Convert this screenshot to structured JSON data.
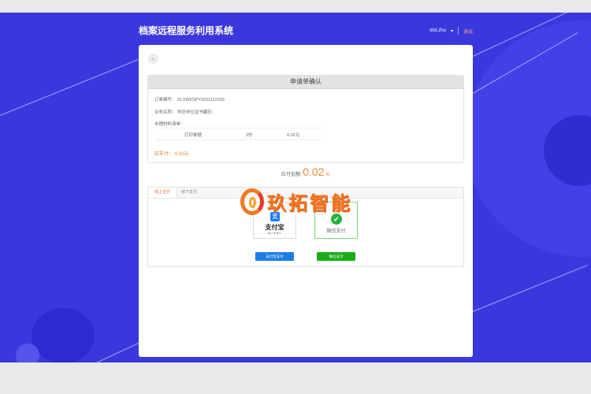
{
  "app": {
    "title": "档案远程服务利用系统"
  },
  "user": {
    "name": "dist.zhu",
    "logout_label": "退出"
  },
  "confirm": {
    "header": "申请单确认",
    "order_label": "订单编号：",
    "order_no": "XLXWZSPY2021112339",
    "business_label": "业务名称：",
    "business_name": "学历学位证书翻印",
    "items_label": "办理材料清单：",
    "items": [
      {
        "name": "打印单据",
        "count": "2份",
        "price": "0.02元"
      }
    ],
    "total_label": "应支付：",
    "total_value": "0.02元"
  },
  "payment": {
    "amount_label": "应付金额:",
    "amount": "0.02",
    "unit": "元",
    "tabs": [
      {
        "label": "线上支付"
      },
      {
        "label": "线下支付"
      }
    ],
    "alipay": {
      "icon_glyph": "支",
      "brand": "支付宝",
      "sub": "ALIPAY",
      "button_label": "支付宝支付"
    },
    "wechat": {
      "icon_glyph": "✔",
      "label": "微信支付",
      "button_label": "微信支付"
    }
  },
  "watermark": {
    "text": "玖拓智能"
  },
  "colors": {
    "background": "#3a38dd",
    "accent": "#e88a3c",
    "alipay": "#1d7de8",
    "wechat": "#1aad19"
  }
}
